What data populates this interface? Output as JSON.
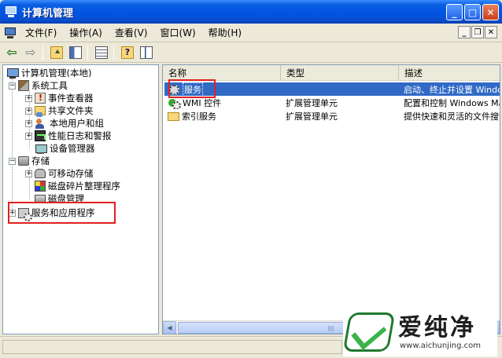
{
  "window": {
    "title": "计算机管理",
    "buttons": {
      "minimize": "_",
      "maximize": "□",
      "close": "✕"
    }
  },
  "menubar": {
    "items": [
      "文件(F)",
      "操作(A)",
      "查看(V)",
      "窗口(W)",
      "帮助(H)"
    ],
    "mdi": {
      "minimize": "_",
      "restore": "❐",
      "close": "✕"
    }
  },
  "toolbar": {
    "icons": [
      "back-arrow",
      "forward-arrow",
      "up-folder",
      "show-hide-tree",
      "export-list",
      "help",
      "properties"
    ],
    "back": "⇦",
    "forward": "⇨",
    "help": "?"
  },
  "tree": {
    "root": "计算机管理(本地)",
    "system_tools": "系统工具",
    "event_viewer": "事件查看器",
    "shared_folders": "共享文件夹",
    "local_users": "本地用户和组",
    "perf_logs": "性能日志和警报",
    "device_manager": "设备管理器",
    "storage": "存储",
    "removable": "可移动存储",
    "defrag": "磁盘碎片整理程序",
    "disk_mgmt": "磁盘管理",
    "services_apps": "服务和应用程序",
    "expand_plus": "+",
    "collapse_minus": "−"
  },
  "list": {
    "columns": [
      "名称",
      "类型",
      "描述"
    ],
    "rows": [
      {
        "name": "服务",
        "type": "",
        "desc": "启动、终止并设置 Windows 服务。",
        "icon": "gear-icon",
        "selected": true
      },
      {
        "name": "WMI 控件",
        "type": "扩展管理单元",
        "desc": "配置和控制 Windows Management Instrumentation",
        "icon": "wmi-icon",
        "selected": false
      },
      {
        "name": "索引服务",
        "type": "扩展管理单元",
        "desc": "提供快速和灵活的文件搜索",
        "icon": "folder-icon",
        "selected": false
      }
    ]
  },
  "scrollbar": {
    "left": "◀",
    "right": "▶"
  },
  "watermark": {
    "name": "爱纯净",
    "url": "www.aichunjing.com"
  },
  "colors": {
    "titlebar": "#0054e3",
    "selection": "#316ac5",
    "highlight_box": "#e02020",
    "brand_green": "#3bb44a"
  }
}
